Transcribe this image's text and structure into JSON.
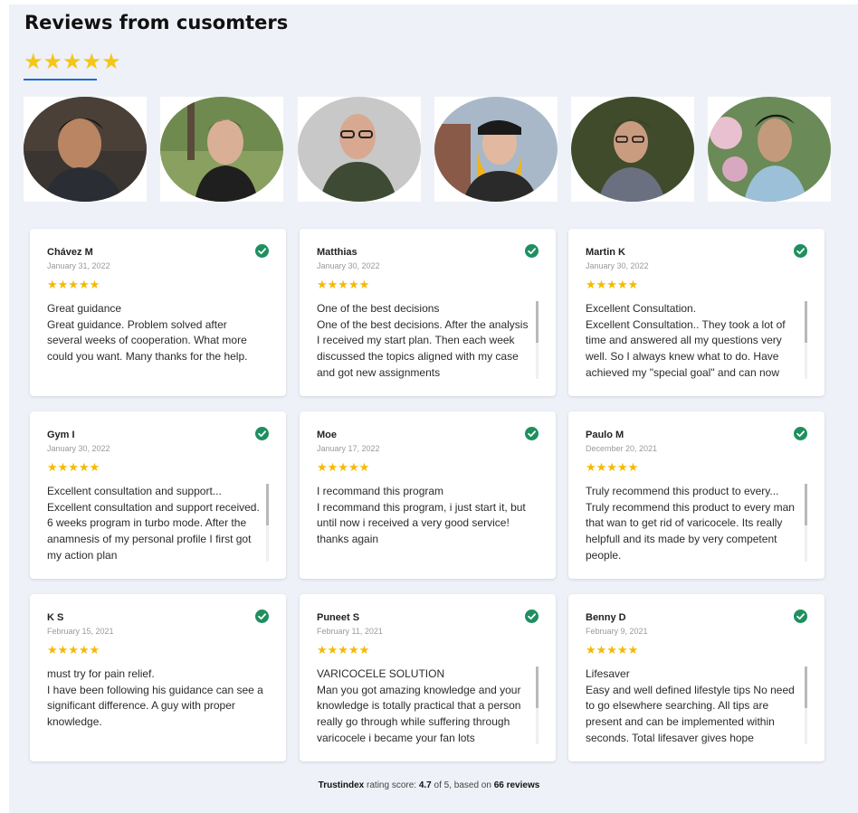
{
  "heading": "Reviews from cusomters",
  "heading_stars": "★★★★★",
  "colors": {
    "accent": "#1e6bd0",
    "star": "#f5c518",
    "verified": "#1f8f5f",
    "panel": "#eef1f7"
  },
  "avatars": [
    {
      "label": "customer-photo-1"
    },
    {
      "label": "customer-photo-2"
    },
    {
      "label": "customer-photo-3"
    },
    {
      "label": "customer-photo-4"
    },
    {
      "label": "customer-photo-5"
    },
    {
      "label": "customer-photo-6"
    }
  ],
  "reviews": [
    {
      "name": "Chávez M",
      "date": "January 31, 2022",
      "stars": "★★★★★",
      "rating": 5,
      "title": "Great guidance",
      "text": "Great guidance. Problem solved after several weeks of cooperation. What more could you want. Many thanks for the help.",
      "scroll": false
    },
    {
      "name": "Matthias",
      "date": "January 30, 2022",
      "stars": "★★★★★",
      "rating": 5,
      "title": "One of the best decisions",
      "text": "One of the best decisions. After the analysis I received my start plan. Then each week discussed the topics aligned with my case and got new assignments",
      "scroll": true
    },
    {
      "name": "Martin K",
      "date": "January 30, 2022",
      "stars": "★★★★★",
      "rating": 5,
      "title": "Excellent Consultation.",
      "text": "Excellent Consultation.. They took a lot of time and answered all my questions very well. So I always knew what to do. Have achieved my \"special goal\" and can now",
      "scroll": true
    },
    {
      "name": "Gym I",
      "date": "January 30, 2022",
      "stars": "★★★★★",
      "rating": 5,
      "title": "Excellent consultation and support...",
      "text": "Excellent consultation and support received. 6 weeks program in turbo mode. After the anamnesis of my personal profile I first got my action plan",
      "scroll": true
    },
    {
      "name": "Moe",
      "date": "January 17, 2022",
      "stars": "★★★★★",
      "rating": 5,
      "title": "I recommand this program",
      "text": "I recommand this program, i just start it, but until now i received a very good service! thanks again",
      "scroll": false
    },
    {
      "name": "Paulo M",
      "date": "December 20, 2021",
      "stars": "★★★★★",
      "rating": 5,
      "title": "Truly recommend this product to every...",
      "text": "Truly recommend this product to every man that wan to get rid of varicocele. Its really helpfull and its made by very competent people.",
      "scroll": true
    },
    {
      "name": "K S",
      "date": "February 15, 2021",
      "stars": "★★★★★",
      "rating": 5,
      "title": "must try for pain relief.",
      "text": "I have been following his guidance can see a significant difference. A guy with proper knowledge.",
      "scroll": false
    },
    {
      "name": "Puneet S",
      "date": "February 11, 2021",
      "stars": "★★★★★",
      "rating": 5,
      "title": "VARICOCELE SOLUTION",
      "text": "Man you got amazing knowledge and your knowledge is totally practical that a person really go through while suffering through varicocele i became your fan lots",
      "scroll": true
    },
    {
      "name": "Benny D",
      "date": "February 9, 2021",
      "stars": "★★★★★",
      "rating": 5,
      "title": "Lifesaver",
      "text": "Easy and well defined lifestyle tips No need to go elsewhere searching. All tips are present and can be implemented within seconds. Total lifesaver gives hope",
      "scroll": true
    }
  ],
  "footer": {
    "brand": "Trustindex",
    "text1": " rating score: ",
    "score": "4.7",
    "text2": " of 5, based on ",
    "count": "66 reviews"
  }
}
